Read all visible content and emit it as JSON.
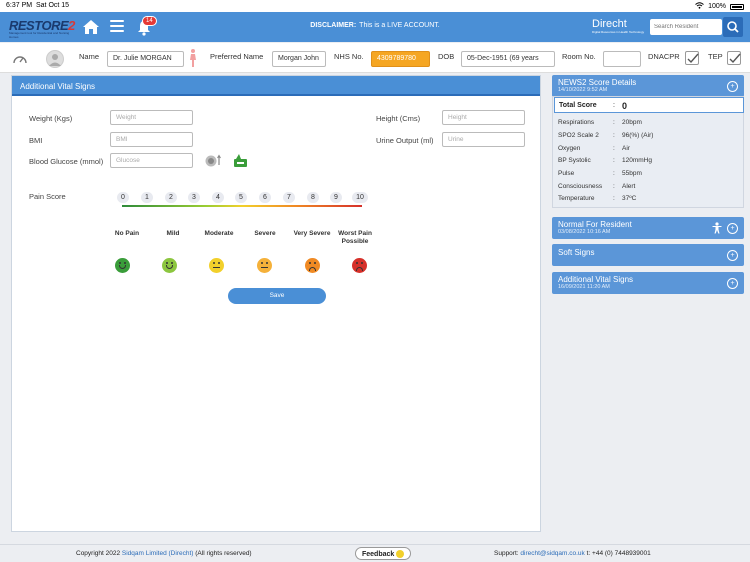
{
  "status": {
    "time": "6:37 PM",
    "date": "Sat Oct 15",
    "battery": "100%"
  },
  "header": {
    "logo_main": "REST",
    "logo_o": "O",
    "logo_re": "RE",
    "logo_two": "2",
    "logo_tag": "Management tool for Residential and Nursing Homes",
    "notification_count": "14",
    "disclaimer_label": "DISCLAIMER:",
    "disclaimer_text": "This is a LIVE ACCOUNT.",
    "brand": "Direcht",
    "brand_tagline": "Digital Resources in Health Technology",
    "search_placeholder": "Search Resident"
  },
  "patient": {
    "name_label": "Name",
    "name": "Dr. Julie MORGAN",
    "preferred_label": "Preferred Name",
    "preferred": "Morgan John",
    "nhs_label": "NHS No.",
    "nhs": "4309789780",
    "dob_label": "DOB",
    "dob": "05-Dec-1951 (69 years",
    "room_label": "Room No.",
    "room": "",
    "dnacpr_label": "DNACPR",
    "tep_label": "TEP"
  },
  "form": {
    "title": "Additional Vital Signs",
    "weight_label": "Weight (Kgs)",
    "weight_placeholder": "Weight",
    "height_label": "Height (Cms)",
    "height_placeholder": "Height",
    "bmi_label": "BMI",
    "bmi_placeholder": "BMI",
    "urine_label": "Urine Output (ml)",
    "urine_placeholder": "Urine",
    "glucose_label": "Blood Glucose (mmol)",
    "glucose_placeholder": "Glucose",
    "pain_label": "Pain Score",
    "pain_numbers": [
      "0",
      "1",
      "2",
      "3",
      "4",
      "5",
      "6",
      "7",
      "8",
      "9",
      "10"
    ],
    "pain_levels": [
      "No Pain",
      "Mild",
      "Moderate",
      "Severe",
      "Very Severe",
      "Worst Pain Possible"
    ],
    "save_label": "Save"
  },
  "news2": {
    "title": "NEWS2 Score Details",
    "date": "14/10/2022 9:52 AM",
    "total_label": "Total Score",
    "total_value": "0",
    "rows": [
      {
        "k": "Respirations",
        "v": "20bpm"
      },
      {
        "k": "SPO2 Scale 2",
        "v": "96(%) (Air)"
      },
      {
        "k": "Oxygen",
        "v": "Air"
      },
      {
        "k": "BP Systolic",
        "v": "120mmHg"
      },
      {
        "k": "Pulse",
        "v": "55bpm"
      },
      {
        "k": "Consciousness",
        "v": "Alert"
      },
      {
        "k": "Temperature",
        "v": "37ºC"
      }
    ]
  },
  "panels": {
    "normal_title": "Normal For Resident",
    "normal_date": "03/08/2022 10:16 AM",
    "soft_title": "Soft Signs",
    "avs_title": "Additional Vital Signs",
    "avs_date": "16/09/2021 11:20 AM"
  },
  "footer": {
    "copyright": "Copyright 2022",
    "company": "Sidqam Limited (Direcht)",
    "rights": "(All rights reserved)",
    "feedback": "Feedback",
    "support_label": "Support:",
    "email": "direcht@sidqam.co.uk",
    "phone": "t: +44 (0) 7448939001"
  },
  "colors": {
    "header": "#4a8fd6",
    "nhs": "#f5a623",
    "panel": "#5b96d8"
  }
}
